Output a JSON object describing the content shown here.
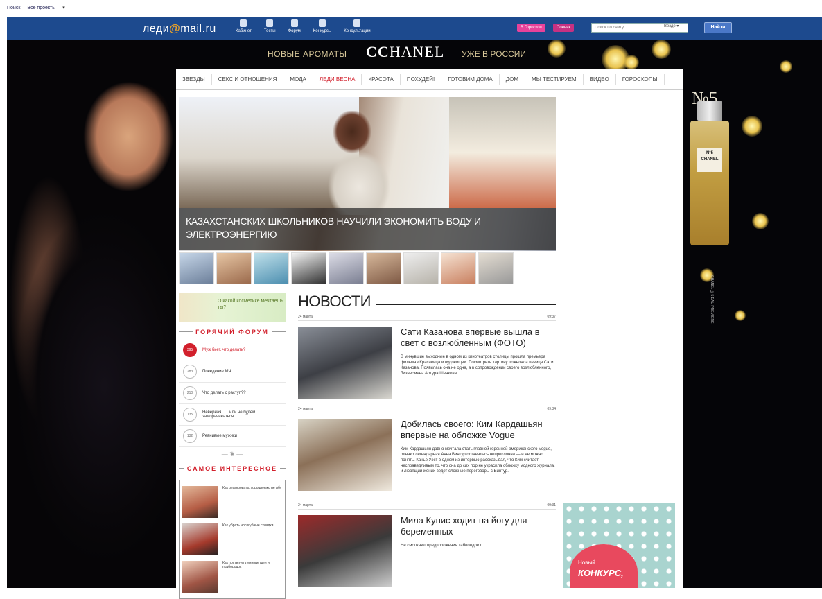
{
  "topbar": {
    "link1": "Поиск",
    "link2": "Все проекты"
  },
  "mailbar": {
    "logo_left": "леди",
    "logo_at": "@",
    "logo_right": "mail.ru",
    "nav": [
      {
        "label": "Кабинет",
        "icon": "person-icon"
      },
      {
        "label": "Тесты",
        "icon": "test-icon"
      },
      {
        "label": "Форум",
        "icon": "forum-icon"
      },
      {
        "label": "Конкурсы",
        "icon": "contest-icon"
      },
      {
        "label": "Консультации",
        "icon": "consult-icon"
      }
    ],
    "pill1": "В Гороскоп",
    "pill2": "Сонник",
    "search_placeholder": "Поиск по сайту",
    "search_scope": "Везде",
    "find_label": "Найти"
  },
  "ad": {
    "left_text": "НОВЫЕ АРОМАТЫ",
    "logo_cc": "CC",
    "logo_text": "HANEL",
    "right_text": "УЖЕ В РОССИИ",
    "no5": "№5",
    "bottle_label": "N°5 CHANEL",
    "side_text": "CHANEL №5 EAU PREMIERE"
  },
  "categories": [
    {
      "label": "ЗВЕЗДЫ",
      "active": false
    },
    {
      "label": "СЕКС И ОТНОШЕНИЯ",
      "active": false
    },
    {
      "label": "МОДА",
      "active": false
    },
    {
      "label": "ЛЕДИ ВЕСНА",
      "active": true
    },
    {
      "label": "КРАСОТА",
      "active": false
    },
    {
      "label": "ПОХУДЕЙ!",
      "active": false
    },
    {
      "label": "ГОТОВИМ ДОМА",
      "active": false
    },
    {
      "label": "ДОМ",
      "active": false
    },
    {
      "label": "МЫ ТЕСТИРУЕМ",
      "active": false
    },
    {
      "label": "ВИДЕО",
      "active": false
    },
    {
      "label": "ГОРОСКОПЫ",
      "active": false
    }
  ],
  "hero": {
    "caption": "КАЗАХСТАНСКИХ ШКОЛЬНИКОВ НАУЧИЛИ ЭКОНОМИТЬ ВОДУ И ЭЛЕКТРОЭНЕРГИЮ"
  },
  "left": {
    "banner": "О какой косметике мечтаешь ты?",
    "forum_title": "ГОРЯЧИЙ ФОРУМ",
    "forum": [
      {
        "count": "395",
        "text": "Муж бьет, что делать?",
        "hot": true
      },
      {
        "count": "283",
        "text": "Поведение МЧ",
        "hot": false
      },
      {
        "count": "210",
        "text": "Что делать с раступ??",
        "hot": false
      },
      {
        "count": "135",
        "text": "Неверная ..... или не будем заморачиваться",
        "hot": false
      },
      {
        "count": "132",
        "text": "Ревнивые мужики",
        "hot": false
      }
    ],
    "interesting_title": "САМОЕ ИНТЕРЕСНОЕ",
    "interesting": [
      {
        "text": "Как реагировать, хорошенько не лбу"
      },
      {
        "text": "Как убрать носогубные складки"
      },
      {
        "text": "Как постигнуть умнице шея и подбородок"
      }
    ]
  },
  "news": {
    "heading": "НОВОСТИ",
    "items": [
      {
        "date": "24 марта",
        "time": "09:37",
        "title": "Сати Казанова впервые вышла в свет с возлюбленным (ФОТО)",
        "text": "В минувшие выходные в одном из кинотеатров столицы прошла премьера фильма «Красавица и чудовище». Посмотреть картину пожелала певица Сати Казанова. Появилась она не одна, а в сопровождении своего возлюбленного, бизнесмена Артура Шенкова."
      },
      {
        "date": "24 марта",
        "time": "09:34",
        "title": "Добилась своего: Ким Кардашьян впервые на обложке Vogue",
        "text": "Ким Кардашьян давно мечтала стать главной героиней американского Vogue, однако легендарная Анна Винтур оставалась непреклонна — и ее можно понять. Канье Уэст в одном из интервью рассказывал, что Ким считает несправедливым то, что она до сих пор не украсила обложку модного журнала, и любящий жених ведет сложные переговоры с Винтур."
      },
      {
        "date": "24 марта",
        "time": "09:31",
        "title": "Мила Кунис ходит на йогу для беременных",
        "text": "Не смолкают предположения таблоидов о"
      }
    ]
  },
  "contest": {
    "line1": "Новый",
    "line2": "КОНКУРС,"
  }
}
